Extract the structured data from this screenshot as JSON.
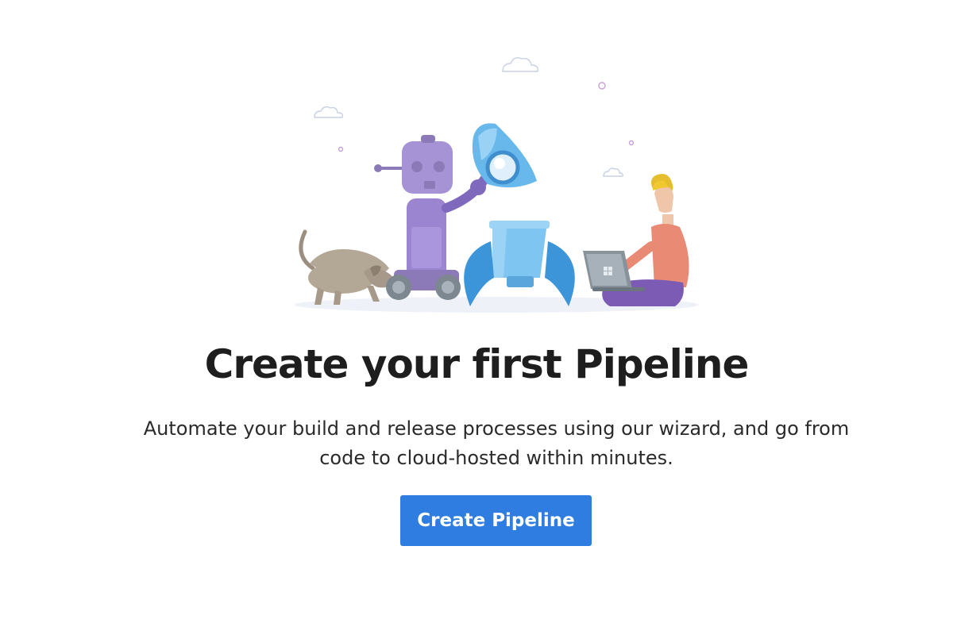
{
  "empty_state": {
    "title": "Create your first Pipeline",
    "description": "Automate your build and release processes using our wizard, and go from code to cloud-hosted within minutes.",
    "primary_button": "Create Pipeline"
  },
  "illustration": {
    "subjects": [
      "dog",
      "robot",
      "rocket",
      "developer-with-laptop"
    ]
  },
  "colors": {
    "accent": "#2f7de1",
    "title_text": "#1e1e1e",
    "body_text": "#2a2a2a"
  }
}
